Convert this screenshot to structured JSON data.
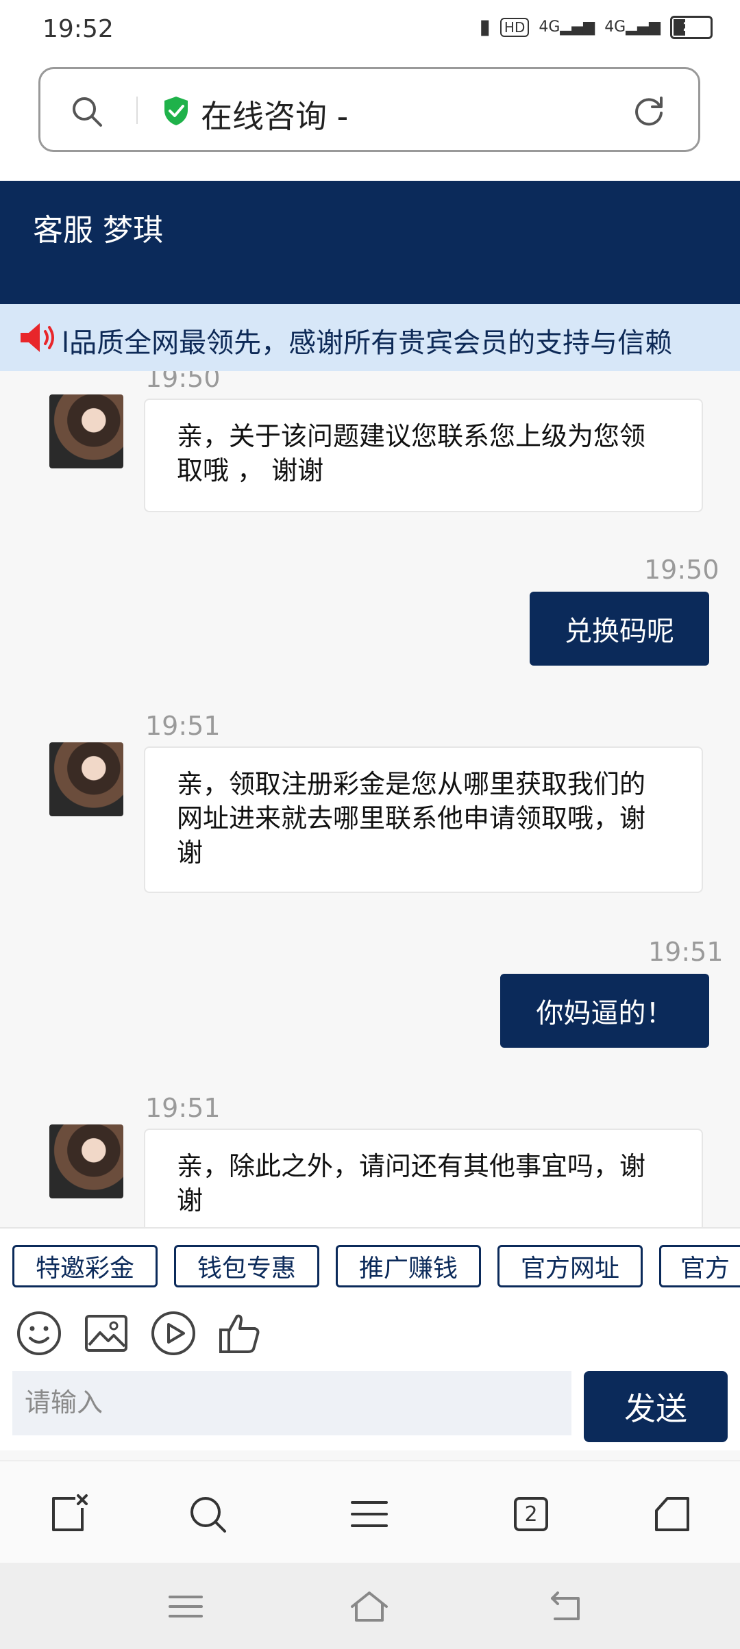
{
  "status": {
    "time": "19:52",
    "hd_label": "HD",
    "signal1": "4G",
    "signal2": "4G",
    "battery": "28"
  },
  "urlbar": {
    "title": "在线咨询  -"
  },
  "chat_header": {
    "title": "客服 梦琪"
  },
  "marquee": {
    "text": "l品质全网最领先，感谢所有贵宾会员的支持与信赖"
  },
  "messages": [
    {
      "side": "left",
      "time": "19:50",
      "text": "亲，关于该问题建议您联系您上级为您领取哦 ， 谢谢"
    },
    {
      "side": "right",
      "time": "19:50",
      "text": "兑换码呢"
    },
    {
      "side": "left",
      "time": "19:51",
      "text": "亲，领取注册彩金是您从哪里获取我们的网址进来就去哪里联系他申请领取哦，谢谢"
    },
    {
      "side": "right",
      "time": "19:51",
      "text": "你妈逼的！"
    },
    {
      "side": "left",
      "time": "19:51",
      "text": "亲，除此之外，请问还有其他事宜吗，谢谢"
    }
  ],
  "quick_buttons": [
    "特邀彩金",
    "钱包专惠",
    "推广赚钱",
    "官方网址",
    "官方"
  ],
  "tools": [
    "emoji-icon",
    "image-icon",
    "video-icon",
    "thumbs-up-icon"
  ],
  "input": {
    "placeholder": "请输入",
    "send_label": "发送"
  },
  "browser_bar": {
    "tab_count": "2"
  },
  "colors": {
    "brand": "#0b2a5a",
    "marquee_bg": "#d7e7f8",
    "shield_green": "#1fb24a",
    "speaker_red": "#e8262a"
  }
}
